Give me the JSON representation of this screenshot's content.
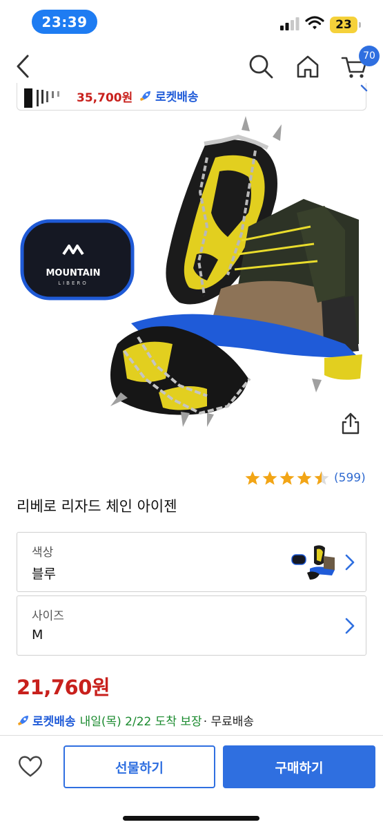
{
  "status_bar": {
    "time": "23:39",
    "battery": "23"
  },
  "nav": {
    "cart_count": "70"
  },
  "mini_bar": {
    "price": "35,700원",
    "rocket_label": "로켓배송"
  },
  "product": {
    "image_brand_lines": [
      "MOUNTAIN",
      "LIBERO"
    ],
    "rating": 4.5,
    "review_count": "(599)",
    "title": "리베로 리자드 체인 아이젠"
  },
  "options": {
    "color": {
      "label": "색상",
      "value": "블루"
    },
    "size": {
      "label": "사이즈",
      "value": "M"
    }
  },
  "price": "21,760원",
  "delivery": {
    "rocket_label": "로켓배송",
    "date_text": "내일(목) 2/22 도착 보장",
    "free_text": "· 무료배송"
  },
  "bottom_bar": {
    "gift_label": "선물하기",
    "buy_label": "구매하기"
  },
  "colors": {
    "accent": "#2f6fe0",
    "price_red": "#c8201c",
    "rocket_blue": "#1f5bd8",
    "delivery_green": "#1a8a2e",
    "star_gold": "#f2a516"
  }
}
